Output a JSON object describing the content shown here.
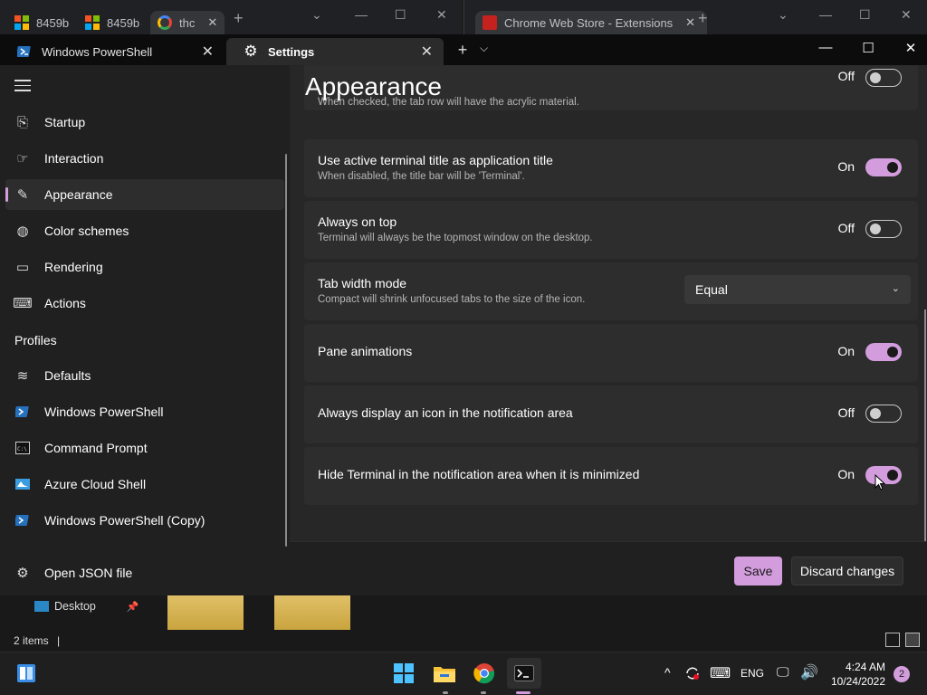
{
  "background_browser": {
    "left_tabs": [
      {
        "label": "8459b",
        "icon": "microsoft-logo-icon"
      },
      {
        "label": "8459b",
        "icon": "microsoft-logo-icon"
      },
      {
        "label": "thc",
        "icon": "google-icon"
      }
    ],
    "right_tab": {
      "label": "Chrome Web Store - Extensions",
      "icon": "chrome-web-store-icon"
    },
    "new_tab_symbol": "+",
    "ctrl_symbols": {
      "dropdown": "⌄",
      "minimize": "—",
      "maximize": "☐",
      "close": "✕"
    }
  },
  "terminal": {
    "tabs": [
      {
        "label": "Windows PowerShell",
        "icon": "powershell-icon",
        "close": "✕"
      },
      {
        "label": "Settings",
        "icon": "gear-icon",
        "close": "✕"
      }
    ],
    "new_tab": "+",
    "tab_dropdown": "⌵",
    "window_controls": {
      "minimize": "—",
      "maximize": "☐",
      "close": "✕"
    }
  },
  "sidebar": {
    "items": [
      {
        "label": "Startup",
        "icon": "startup-icon",
        "glyph": "⎘"
      },
      {
        "label": "Interaction",
        "icon": "interaction-icon",
        "glyph": "☞"
      },
      {
        "label": "Appearance",
        "icon": "brush-icon",
        "glyph": "✎",
        "selected": true
      },
      {
        "label": "Color schemes",
        "icon": "palette-icon",
        "glyph": "◍"
      },
      {
        "label": "Rendering",
        "icon": "monitor-icon",
        "glyph": "▭"
      },
      {
        "label": "Actions",
        "icon": "keyboard-icon",
        "glyph": "⌨"
      }
    ],
    "profiles_header": "Profiles",
    "profiles": [
      {
        "label": "Defaults",
        "icon": "layers-icon",
        "glyph": "≋"
      },
      {
        "label": "Windows PowerShell",
        "icon": "powershell-icon",
        "glyph": "❯"
      },
      {
        "label": "Command Prompt",
        "icon": "cmd-icon",
        "glyph": "▣"
      },
      {
        "label": "Azure Cloud Shell",
        "icon": "azure-icon",
        "glyph": "☁"
      },
      {
        "label": "Windows PowerShell (Copy)",
        "icon": "powershell-icon",
        "glyph": "❯"
      }
    ],
    "open_json": {
      "label": "Open JSON file",
      "icon": "gear-icon",
      "glyph": "⚙"
    }
  },
  "main": {
    "title": "Appearance",
    "partial_setting": {
      "desc": "When checked, the tab row will have the acrylic material.",
      "state": "Off"
    },
    "settings": [
      {
        "title": "Use active terminal title as application title",
        "desc": "When disabled, the title bar will be 'Terminal'.",
        "state": "On",
        "on": true
      },
      {
        "title": "Always on top",
        "desc": "Terminal will always be the topmost window on the desktop.",
        "state": "Off",
        "on": false
      },
      {
        "title": "Pane animations",
        "desc": "",
        "state": "On",
        "on": true
      },
      {
        "title": "Always display an icon in the notification area",
        "desc": "",
        "state": "Off",
        "on": false
      },
      {
        "title": "Hide Terminal in the notification area when it is minimized",
        "desc": "",
        "state": "On",
        "on": true
      }
    ],
    "tab_width": {
      "title": "Tab width mode",
      "desc": "Compact will shrink unfocused tabs to the size of the icon.",
      "value": "Equal"
    }
  },
  "footer": {
    "save": "Save",
    "discard": "Discard changes"
  },
  "explorer": {
    "desktop_label": "Desktop",
    "items_count": "2 items"
  },
  "taskbar": {
    "apps": [
      "windows-start-icon",
      "file-explorer-icon",
      "chrome-icon",
      "terminal-icon"
    ],
    "tray": {
      "lang": "ENG",
      "caret": "^"
    },
    "clock_time": "4:24 AM",
    "clock_date": "10/24/2022",
    "notifications": "2"
  },
  "colors": {
    "accent": "#d39ddd",
    "card": "#2d2d2d",
    "main_bg": "#272727",
    "sidebar_bg": "#202020"
  }
}
